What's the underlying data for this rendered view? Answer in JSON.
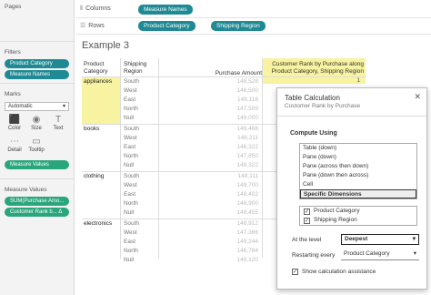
{
  "left": {
    "pages_label": "Pages",
    "filters_label": "Filters",
    "filter_pills": [
      "Product Category",
      "Measure Names"
    ],
    "marks_label": "Marks",
    "marks_type": "Automatic",
    "mark_cells": [
      {
        "icon": "color-icon",
        "glyph": "⬛",
        "label": "Color"
      },
      {
        "icon": "size-icon",
        "glyph": "◉",
        "label": "Size"
      },
      {
        "icon": "text-icon",
        "glyph": "T",
        "label": "Text"
      },
      {
        "icon": "detail-icon",
        "glyph": "⋯",
        "label": "Detail"
      },
      {
        "icon": "tooltip-icon",
        "glyph": "▭",
        "label": "Tooltip"
      }
    ],
    "measure_values_pill": "Measure Values",
    "measure_values_label": "Measure Values",
    "measure_value_pills": [
      "SUM(Purchase Amo...",
      "Customer Rank b... Δ"
    ]
  },
  "shelves": {
    "columns_label": "Columns",
    "columns_pill": "Measure Names",
    "rows_label": "Rows",
    "rows_pills": [
      "Product Category",
      "Shipping Region"
    ]
  },
  "viz": {
    "title": "Example 3",
    "hdr_category": "Product Category",
    "hdr_region": "Shipping Region",
    "hdr_amount": "Purchase Amount",
    "hdr_rank": "Customer Rank by Purchase along Product Category, Shipping Region",
    "categories": [
      "appliances",
      "books",
      "clothing",
      "electronics"
    ],
    "regions": [
      "South",
      "West",
      "East",
      "North",
      "Null"
    ],
    "amounts": [
      [
        "148,528",
        "146,500",
        "149,118",
        "147,509",
        "149,000"
      ],
      [
        "149,488",
        "148,211",
        "146,322",
        "147,850",
        "149,322"
      ],
      [
        "148,111",
        "149,700",
        "148,402",
        "146,900",
        "149,455"
      ],
      [
        "148,912",
        "147,366",
        "149,244",
        "146,784",
        "149,120"
      ]
    ],
    "first_rank": "1"
  },
  "dialog": {
    "title": "Table Calculation",
    "subtitle": "Customer Rank by Purchase",
    "compute_label": "Compute Using",
    "compute_options": [
      "Table (down)",
      "Pane (down)",
      "Pane (across then down)",
      "Pane (down then across)",
      "Cell",
      "Specific Dimensions"
    ],
    "selected_option": "Specific Dimensions",
    "dimensions": [
      "Product Category",
      "Shipping Region"
    ],
    "at_level_label": "At the level",
    "at_level_value": "Deepest",
    "restarting_label": "Restarting every",
    "restarting_value": "Product Category",
    "show_assist_label": "Show calculation assistance"
  },
  "colors": {
    "pill_blue": "#1f8a94",
    "pill_green": "#2aa67c",
    "highlight": "#f7f3a0"
  }
}
